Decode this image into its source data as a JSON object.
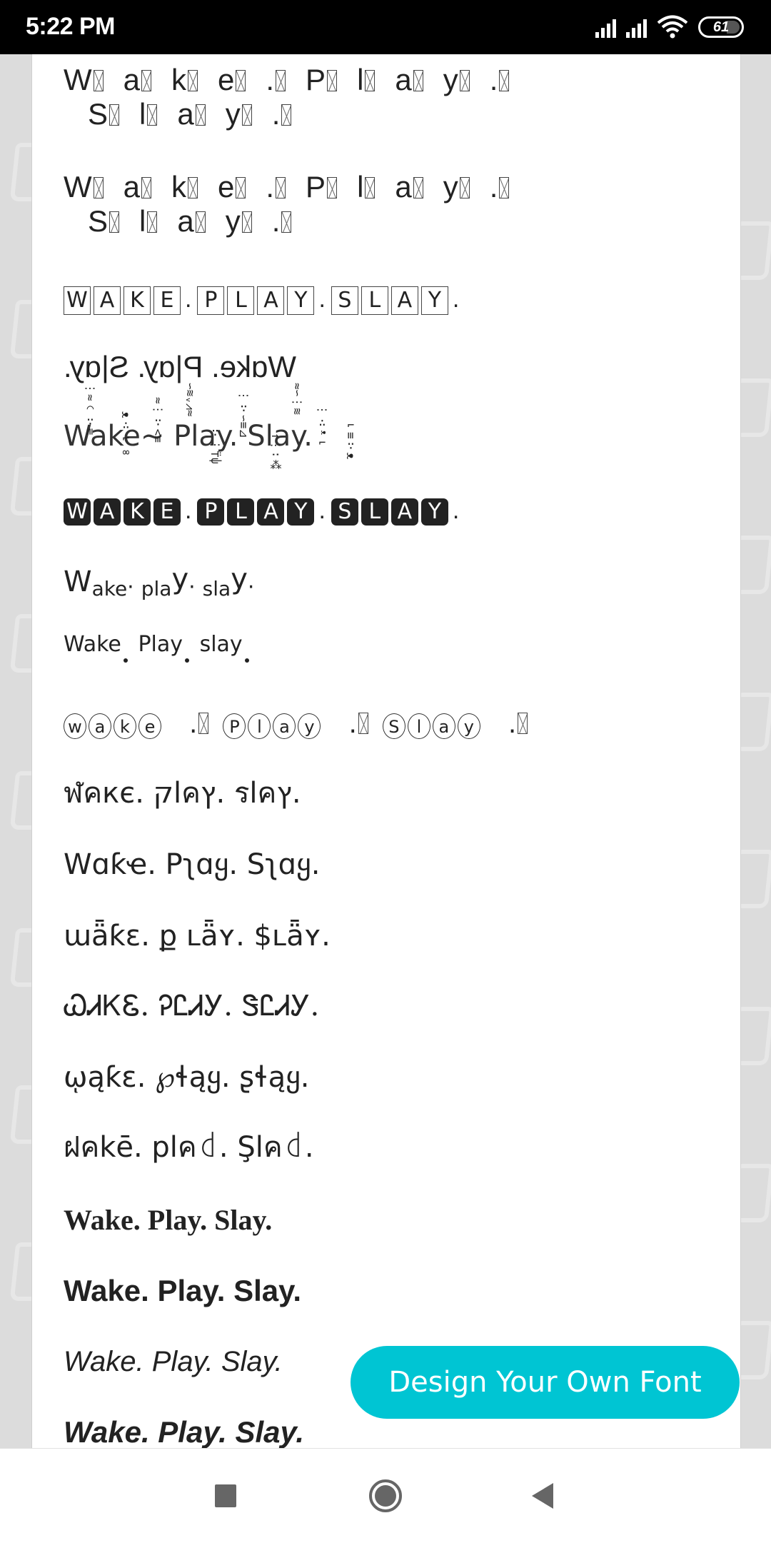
{
  "status_bar": {
    "time": "5:22 PM",
    "battery_level": "61",
    "icons": [
      "signal-icon",
      "signal-icon",
      "wifi-icon",
      "battery-icon"
    ]
  },
  "phrase": "Wake. Play. Slay.",
  "font_samples": [
    {
      "id": "tofu-1",
      "line1": [
        "W",
        "a",
        "k",
        "e",
        ".",
        "P",
        "l",
        "a",
        "y",
        "."
      ],
      "line2": [
        "S",
        "l",
        "a",
        "y",
        "."
      ]
    },
    {
      "id": "tofu-2",
      "line1": [
        "W",
        "a",
        "k",
        "e",
        ".",
        "P",
        "l",
        "a",
        "y",
        "."
      ],
      "line2": [
        "S",
        "l",
        "a",
        "y",
        "."
      ]
    },
    {
      "id": "squared",
      "words": [
        [
          "W",
          "A",
          "K",
          "E"
        ],
        [
          "P",
          "L",
          "A",
          "Y"
        ],
        [
          "S",
          "L",
          "A",
          "Y"
        ]
      ],
      "separator": "."
    },
    {
      "id": "mirrored",
      "text": "Wɑke. P|ɑy. S|ɑy."
    },
    {
      "id": "zalgo",
      "text": "Wake~ Play. Slay."
    },
    {
      "id": "negative-squared",
      "words": [
        [
          "W",
          "A",
          "K",
          "E"
        ],
        [
          "P",
          "L",
          "A",
          "Y"
        ],
        [
          "S",
          "L",
          "A",
          "Y"
        ]
      ],
      "separator": "."
    },
    {
      "id": "subscript",
      "big_w": "W",
      "w1_rest": "ake",
      "w2": "pla",
      "w2_y": "y",
      "w3": "sla",
      "w3_y": "y",
      "dot": "·"
    },
    {
      "id": "low-dot",
      "words": [
        "Wake",
        "Play",
        "slay"
      ]
    },
    {
      "id": "circled",
      "words": [
        [
          "w",
          "a",
          "k",
          "e"
        ],
        [
          "P",
          "l",
          "a",
          "y"
        ],
        [
          "S",
          "l",
          "a",
          "y"
        ]
      ],
      "separator": "."
    },
    {
      "id": "thai-style",
      "text": "ฬคкє. קlคץ. รlคץ."
    },
    {
      "id": "curly",
      "text": "Wɑƙҽ. Pʅɑყ. Sʅɑყ."
    },
    {
      "id": "diaeresis",
      "text": "ɯǟƙɛ. ք ʟǟʏ. $ʟǟʏ."
    },
    {
      "id": "ancient",
      "text": "ᏇᏗᏦᏋ. ᎮᏝᏗᎩ. ᏕᏝᏗᎩ."
    },
    {
      "id": "hooked",
      "text": "ῳąƙɛ. ℘ɬąყ. ʂɬąყ."
    },
    {
      "id": "thai-2",
      "text": "ฝคkē. plค꒯. Şlค꒯."
    },
    {
      "id": "serif-bold",
      "text": "Wake. Play. Slay."
    },
    {
      "id": "sans-bold",
      "text": "Wake. Play. Slay."
    },
    {
      "id": "sans-italic",
      "text": "Wake. Play. Slay."
    },
    {
      "id": "sans-bold-italic",
      "text": "Wake. Play. Slay."
    }
  ],
  "cta": {
    "label": "Design Your Own Font",
    "color": "#00c5d3"
  },
  "nav_bar": {
    "recents": "recents-icon",
    "home": "home-icon",
    "back": "back-icon"
  }
}
